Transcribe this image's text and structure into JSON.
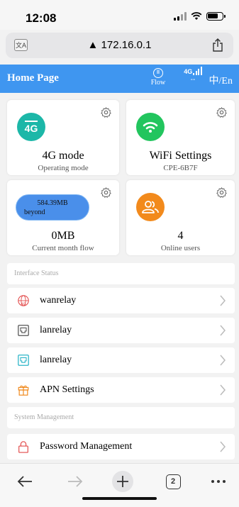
{
  "status_bar": {
    "time": "12:08"
  },
  "browser": {
    "url": "▲ 172.16.0.1",
    "translate_label": "文A",
    "open_tabs": "2"
  },
  "header": {
    "title": "Home Page",
    "flow_icon_text": "⑪",
    "flow_label": "Flow",
    "network_icon_text": "4G",
    "network_label": "--",
    "language": "中/En",
    "color": "#3f96f0"
  },
  "cards": {
    "mode": {
      "badge": "4G",
      "title": "4G mode",
      "subtitle": "Operating mode",
      "icon_color": "#1cb7a8"
    },
    "wifi": {
      "title": "WiFi Settings",
      "subtitle": "CPE-6B7F",
      "icon_color": "#22c55e"
    },
    "flow": {
      "pill_value": "584.39MB",
      "pill_note": "beyond",
      "title": "0MB",
      "subtitle": "Current month flow"
    },
    "users": {
      "title": "4",
      "subtitle": "Online users",
      "icon_color": "#f28a1c"
    }
  },
  "sections": {
    "interface_status": "Interface Status",
    "system_management": "System Management"
  },
  "rows": [
    {
      "label": "wanrelay",
      "icon": "globe-4g-icon"
    },
    {
      "label": "lanrelay",
      "icon": "ethernet-port-icon"
    },
    {
      "label": "lanrelay",
      "icon": "ethernet-port-icon"
    },
    {
      "label": "APN Settings",
      "icon": "gift-box-icon"
    },
    {
      "label": "Password Management",
      "icon": "lock-icon"
    }
  ]
}
